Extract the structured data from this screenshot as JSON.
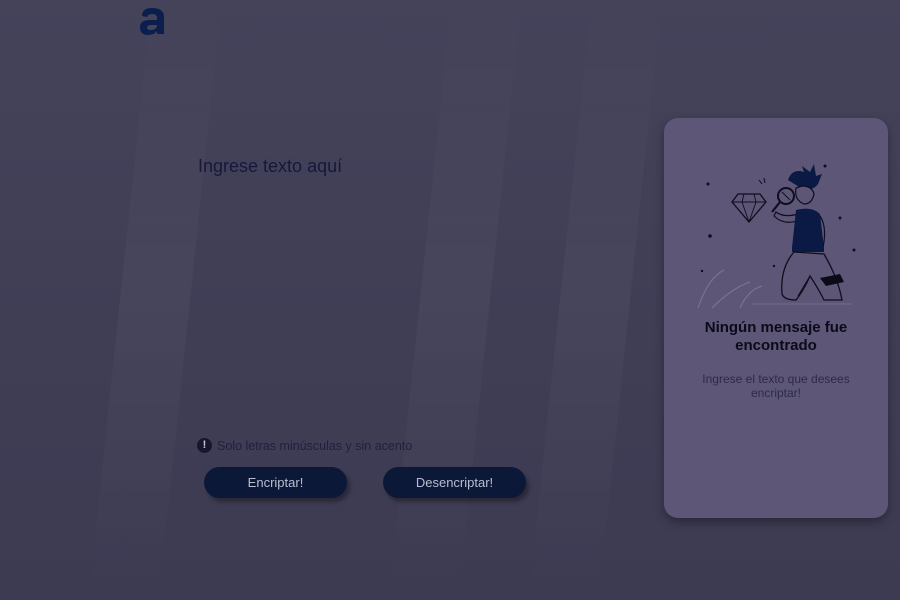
{
  "app": {
    "logo_letter": "a",
    "logo_color": "#0b1e4d"
  },
  "editor": {
    "placeholder": "Ingrese texto aquí",
    "value": ""
  },
  "hint": {
    "icon": "exclamation-circle-icon",
    "text": "Solo letras minúsculas y sin acento"
  },
  "buttons": {
    "encrypt_label": "Encriptar!",
    "decrypt_label": "Desencriptar!"
  },
  "result_panel": {
    "illustration": "person-with-magnifier-and-diamond-illustration",
    "title_line1": "Ningún mensaje fue",
    "title_line2": "encontrado",
    "subtitle": "Ingrese el texto que desees encriptar!"
  },
  "colors": {
    "background": "#434157",
    "panel": "#5d5677",
    "button": "#0c1838",
    "button_text": "#b9bfd0"
  }
}
